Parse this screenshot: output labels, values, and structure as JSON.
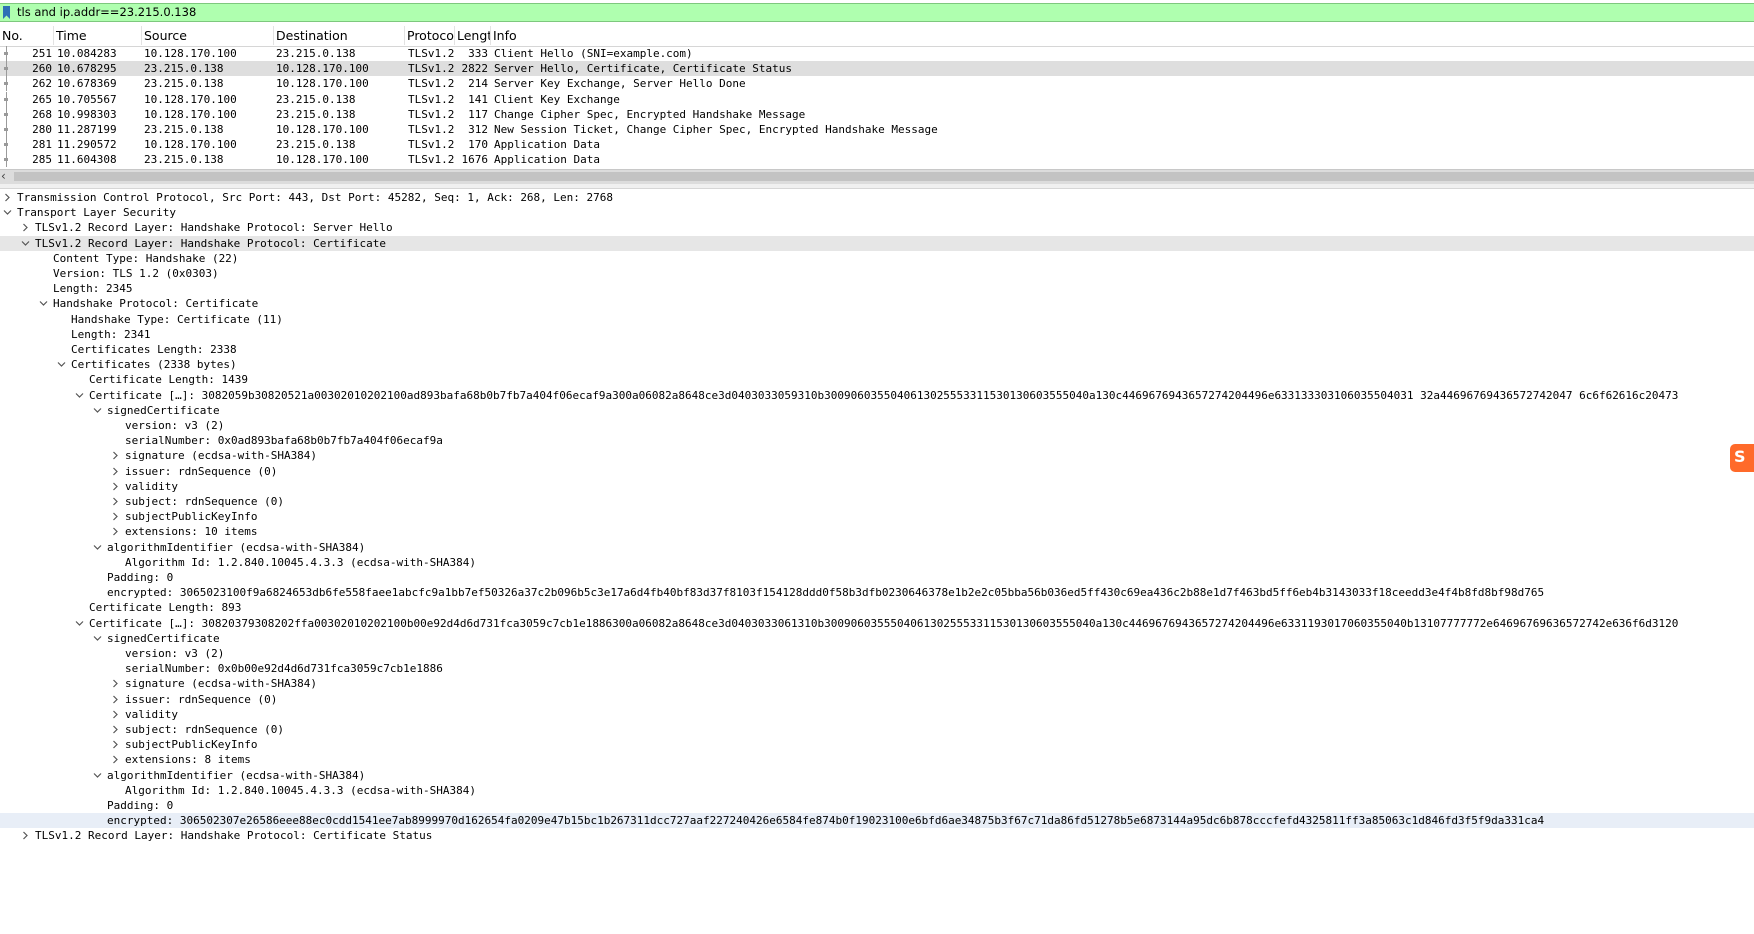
{
  "filter": {
    "value": "tls and ip.addr==23.215.0.138"
  },
  "columns": [
    "No.",
    "Time",
    "Source",
    "Destination",
    "Protoco",
    "Lengt",
    "Info"
  ],
  "packets": [
    {
      "no": "251",
      "time": "10.084283",
      "src": "10.128.170.100",
      "dst": "23.215.0.138",
      "proto": "TLSv1.2",
      "len": "333",
      "info": "Client Hello (SNI=example.com)"
    },
    {
      "no": "260",
      "time": "10.678295",
      "src": "23.215.0.138",
      "dst": "10.128.170.100",
      "proto": "TLSv1.2",
      "len": "2822",
      "info": "Server Hello, Certificate, Certificate Status"
    },
    {
      "no": "262",
      "time": "10.678369",
      "src": "23.215.0.138",
      "dst": "10.128.170.100",
      "proto": "TLSv1.2",
      "len": "214",
      "info": "Server Key Exchange, Server Hello Done"
    },
    {
      "no": "265",
      "time": "10.705567",
      "src": "10.128.170.100",
      "dst": "23.215.0.138",
      "proto": "TLSv1.2",
      "len": "141",
      "info": "Client Key Exchange"
    },
    {
      "no": "268",
      "time": "10.998303",
      "src": "10.128.170.100",
      "dst": "23.215.0.138",
      "proto": "TLSv1.2",
      "len": "117",
      "info": "Change Cipher Spec, Encrypted Handshake Message"
    },
    {
      "no": "280",
      "time": "11.287199",
      "src": "23.215.0.138",
      "dst": "10.128.170.100",
      "proto": "TLSv1.2",
      "len": "312",
      "info": "New Session Ticket, Change Cipher Spec, Encrypted Handshake Message"
    },
    {
      "no": "281",
      "time": "11.290572",
      "src": "10.128.170.100",
      "dst": "23.215.0.138",
      "proto": "TLSv1.2",
      "len": "170",
      "info": "Application Data"
    },
    {
      "no": "285",
      "time": "11.604308",
      "src": "23.215.0.138",
      "dst": "10.128.170.100",
      "proto": "TLSv1.2",
      "len": "1676",
      "info": "Application Data"
    }
  ],
  "selected_packet_index": 1,
  "tree": [
    {
      "text": "Transmission Control Protocol, Src Port: 443, Dst Port: 45282, Seq: 1, Ack: 268, Len: 2768",
      "depth": 0,
      "toggle": "collapsed"
    },
    {
      "text": "Transport Layer Security",
      "depth": 0,
      "toggle": "expanded"
    },
    {
      "text": "TLSv1.2 Record Layer: Handshake Protocol: Server Hello",
      "depth": 1,
      "toggle": "collapsed"
    },
    {
      "text": "TLSv1.2 Record Layer: Handshake Protocol: Certificate",
      "depth": 1,
      "toggle": "expanded",
      "highlight": true
    },
    {
      "text": "Content Type: Handshake (22)",
      "depth": 2,
      "toggle": "none"
    },
    {
      "text": "Version: TLS 1.2 (0x0303)",
      "depth": 2,
      "toggle": "none"
    },
    {
      "text": "Length: 2345",
      "depth": 2,
      "toggle": "none"
    },
    {
      "text": "Handshake Protocol: Certificate",
      "depth": 2,
      "toggle": "expanded"
    },
    {
      "text": "Handshake Type: Certificate (11)",
      "depth": 3,
      "toggle": "none"
    },
    {
      "text": "Length: 2341",
      "depth": 3,
      "toggle": "none"
    },
    {
      "text": "Certificates Length: 2338",
      "depth": 3,
      "toggle": "none"
    },
    {
      "text": "Certificates (2338 bytes)",
      "depth": 3,
      "toggle": "expanded"
    },
    {
      "text": "Certificate Length: 1439",
      "depth": 4,
      "toggle": "none"
    },
    {
      "text": "Certificate […]: 3082059b30820521a00302010202100ad893bafa68b0b7fb7a404f06ecaf9a300a06082a8648ce3d0403033059310b3009060355040613025553311530130603555040a130c4469676943657274204496e633133303106035504031 32a44696769436572742047 6c6f62616c20473",
      "depth": 4,
      "toggle": "expanded"
    },
    {
      "text": "signedCertificate",
      "depth": 5,
      "toggle": "expanded"
    },
    {
      "text": "version: v3 (2)",
      "depth": 6,
      "toggle": "none"
    },
    {
      "text": "serialNumber: 0x0ad893bafa68b0b7fb7a404f06ecaf9a",
      "depth": 6,
      "toggle": "none"
    },
    {
      "text": "signature (ecdsa-with-SHA384)",
      "depth": 6,
      "toggle": "collapsed"
    },
    {
      "text": "issuer: rdnSequence (0)",
      "depth": 6,
      "toggle": "collapsed"
    },
    {
      "text": "validity",
      "depth": 6,
      "toggle": "collapsed"
    },
    {
      "text": "subject: rdnSequence (0)",
      "depth": 6,
      "toggle": "collapsed"
    },
    {
      "text": "subjectPublicKeyInfo",
      "depth": 6,
      "toggle": "collapsed"
    },
    {
      "text": "extensions: 10 items",
      "depth": 6,
      "toggle": "collapsed"
    },
    {
      "text": "algorithmIdentifier (ecdsa-with-SHA384)",
      "depth": 5,
      "toggle": "expanded"
    },
    {
      "text": "Algorithm Id: 1.2.840.10045.4.3.3 (ecdsa-with-SHA384)",
      "depth": 6,
      "toggle": "none"
    },
    {
      "text": "Padding: 0",
      "depth": 5,
      "toggle": "none"
    },
    {
      "text": "encrypted: 3065023100f9a6824653db6fe558faee1abcfc9a1bb7ef50326a37c2b096b5c3e17a6d4fb40bf83d37f8103f154128ddd0f58b3dfb0230646378e1b2e2c05bba56b036ed5ff430c69ea436c2b88e1d7f463bd5ff6eb4b3143033f18ceedd3e4f4b8fd8bf98d765",
      "depth": 5,
      "toggle": "none"
    },
    {
      "text": "Certificate Length: 893",
      "depth": 4,
      "toggle": "none"
    },
    {
      "text": "Certificate […]: 30820379308202ffa00302010202100b00e92d4d6d731fca3059c7cb1e1886300a06082a8648ce3d0403033061310b30090603555040613025553311530130603555040a130c4469676943657274204496e6331193017060355040b13107777772e64696769636572742e636f6d3120",
      "depth": 4,
      "toggle": "expanded"
    },
    {
      "text": "signedCertificate",
      "depth": 5,
      "toggle": "expanded"
    },
    {
      "text": "version: v3 (2)",
      "depth": 6,
      "toggle": "none"
    },
    {
      "text": "serialNumber: 0x0b00e92d4d6d731fca3059c7cb1e1886",
      "depth": 6,
      "toggle": "none"
    },
    {
      "text": "signature (ecdsa-with-SHA384)",
      "depth": 6,
      "toggle": "collapsed"
    },
    {
      "text": "issuer: rdnSequence (0)",
      "depth": 6,
      "toggle": "collapsed"
    },
    {
      "text": "validity",
      "depth": 6,
      "toggle": "collapsed"
    },
    {
      "text": "subject: rdnSequence (0)",
      "depth": 6,
      "toggle": "collapsed"
    },
    {
      "text": "subjectPublicKeyInfo",
      "depth": 6,
      "toggle": "collapsed"
    },
    {
      "text": "extensions: 8 items",
      "depth": 6,
      "toggle": "collapsed"
    },
    {
      "text": "algorithmIdentifier (ecdsa-with-SHA384)",
      "depth": 5,
      "toggle": "expanded"
    },
    {
      "text": "Algorithm Id: 1.2.840.10045.4.3.3 (ecdsa-with-SHA384)",
      "depth": 6,
      "toggle": "none"
    },
    {
      "text": "Padding: 0",
      "depth": 5,
      "toggle": "none"
    },
    {
      "text": "encrypted: 306502307e26586eee88ec0cdd1541ee7ab8999970d162654fa0209e47b15bc1b267311dcc727aaf227240426e6584fe874b0f19023100e6bfd6ae34875b3f67c71da86fd51278b5e6873144a95dc6b878cccfefd4325811ff3a85063c1d846fd3f5f9da331ca4",
      "depth": 5,
      "toggle": "none",
      "highlight_blue": true
    },
    {
      "text": "TLSv1.2 Record Layer: Handshake Protocol: Certificate Status",
      "depth": 1,
      "toggle": "collapsed"
    }
  ],
  "ime_badge": {
    "label": "S",
    "color": "#ff6a2a"
  },
  "colors": {
    "filter_bg": "#afffaf",
    "selected_row": "#dedede"
  }
}
